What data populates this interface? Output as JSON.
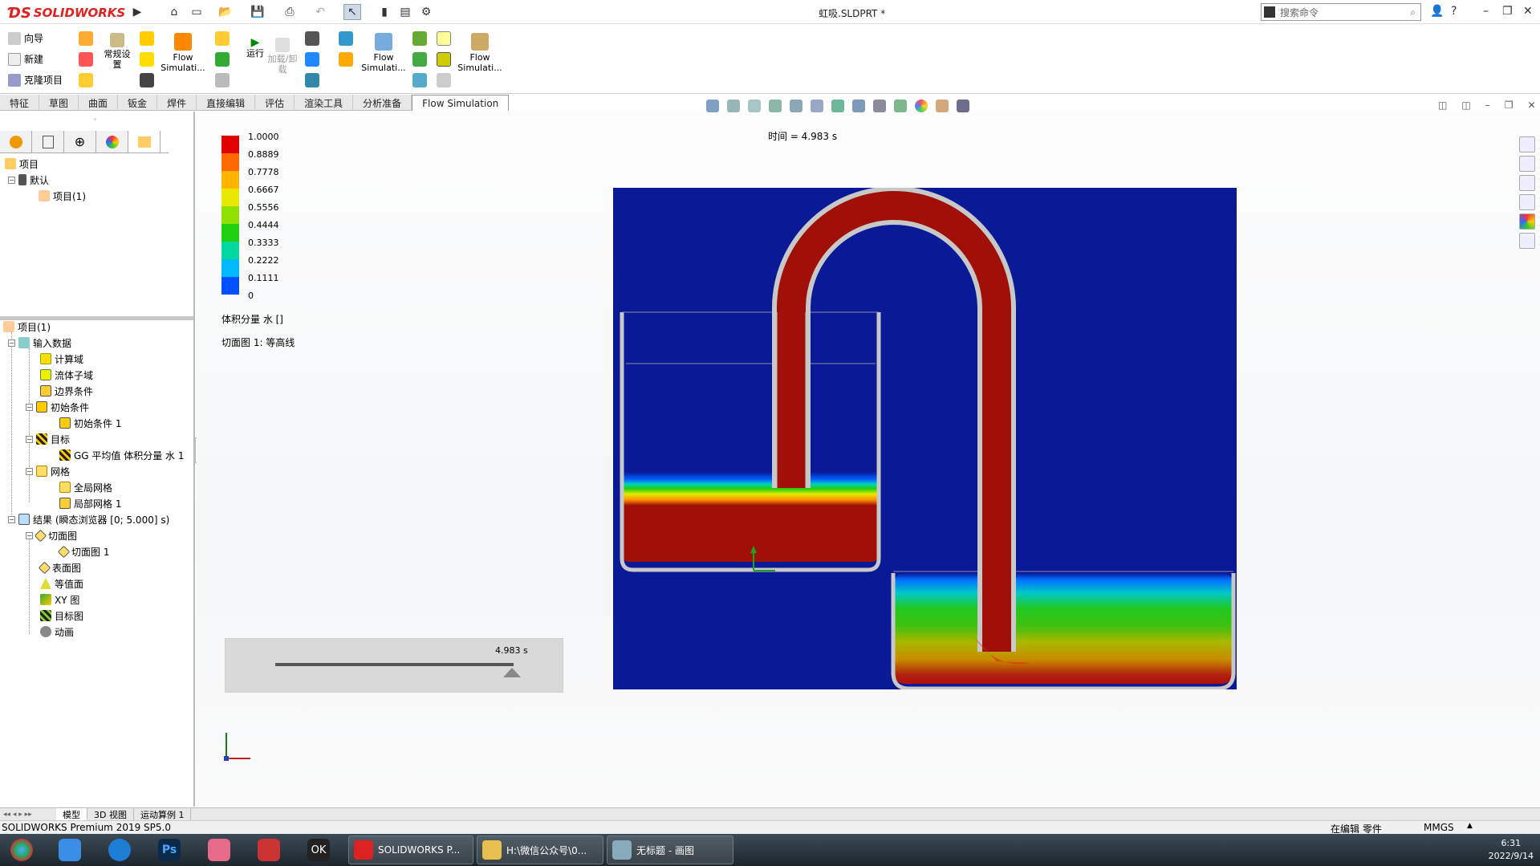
{
  "app": {
    "brand": "SOLIDWORKS",
    "document_title": "虹吸.SLDPRT *",
    "search_placeholder": "搜索命令"
  },
  "command_manager": {
    "left_items": [
      "向导",
      "新建",
      "克隆项目"
    ],
    "general_settings": "常规设\n置",
    "flow_sim_1": "Flow\nSimulati...",
    "run": "运行",
    "load_unload": "加载/卸\n载",
    "flow_sim_2": "Flow\nSimulati...",
    "flow_sim_3": "Flow\nSimulati..."
  },
  "tabs": [
    "特征",
    "草图",
    "曲面",
    "钣金",
    "焊件",
    "直接编辑",
    "评估",
    "渲染工具",
    "分析准备",
    "Flow Simulation"
  ],
  "active_tab": "Flow Simulation",
  "feature_tree": {
    "root": "项目",
    "default": "默认",
    "project": "项目(1)"
  },
  "analysis_tree": {
    "root": "项目(1)",
    "input": "输入数据",
    "domain": "计算域",
    "fluid": "流体子域",
    "boundary": "边界条件",
    "initial": "初始条件",
    "initial1": "初始条件 1",
    "goals": "目标",
    "goal1": "GG 平均值 体积分量 水 1",
    "mesh": "网格",
    "global_mesh": "全局网格",
    "local_mesh": "局部网格 1",
    "results": "结果 (瞬态浏览器 [0; 5.000] s)",
    "cut_plots": "切面图",
    "cut_plot1": "切面图 1",
    "surface_plots": "表面图",
    "isosurfaces": "等值面",
    "xy_plots": "XY 图",
    "goal_plots": "目标图",
    "animations": "动画"
  },
  "legend": {
    "labels": [
      "1.0000",
      "0.8889",
      "0.7778",
      "0.6667",
      "0.5556",
      "0.4444",
      "0.3333",
      "0.2222",
      "0.1111",
      "0"
    ],
    "colors": [
      "#e00000",
      "#ff6a00",
      "#ffb400",
      "#e8e800",
      "#90e000",
      "#20d010",
      "#00d8a0",
      "#00b8ff",
      "#0050ff",
      "#0000e0"
    ],
    "title": "体积分量 水 []",
    "subtitle": "切面图 1: 等高线"
  },
  "time_label": "时间 = 4.983 s",
  "slider_time": "4.983 s",
  "slider_fraction": 0.997,
  "bottom_tabs": [
    "模型",
    "3D 视图",
    "运动算例 1"
  ],
  "status": {
    "version": "SOLIDWORKS Premium 2019 SP5.0",
    "editing": "在编辑 零件",
    "units": "MMGS"
  },
  "taskbar": {
    "windows": [
      "SOLIDWORKS P...",
      "H:\\微信公众号\\0...",
      "无标题 - 画图"
    ],
    "time": "6:31",
    "date": "2022/9/14"
  },
  "colors": {
    "domain_blue": "#0a1a96",
    "water_red": "#a01008",
    "wall_gray": "#c8c8c8"
  }
}
